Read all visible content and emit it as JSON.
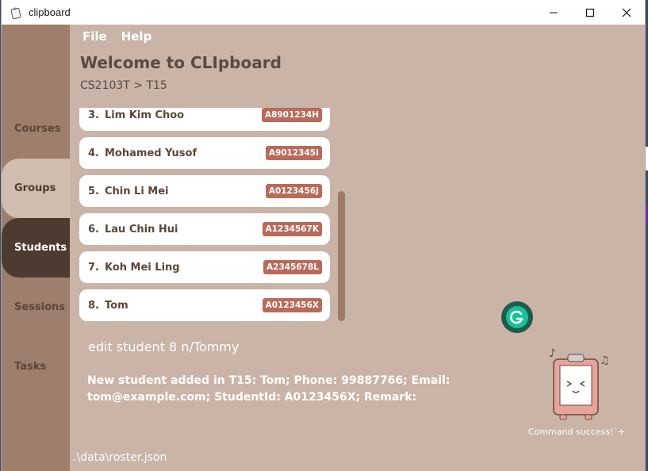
{
  "window": {
    "title": "clipboard",
    "icon": "clipboard-app-icon",
    "controls": [
      "minimize-icon",
      "maximize-icon",
      "close-icon"
    ]
  },
  "menu": {
    "file": "File",
    "help": "Help"
  },
  "sidebar": {
    "items": [
      {
        "label": "Courses",
        "state": "normal"
      },
      {
        "label": "Groups",
        "state": "hover"
      },
      {
        "label": "Students",
        "state": "active"
      },
      {
        "label": "Sessions",
        "state": "normal"
      },
      {
        "label": "Tasks",
        "state": "normal"
      }
    ]
  },
  "header": {
    "welcome": "Welcome to CLIpboard",
    "breadcrumb": "CS2103T > T15"
  },
  "students": [
    {
      "number": "3.",
      "name": "Lim Kim Choo",
      "id": "A8901234H"
    },
    {
      "number": "4.",
      "name": "Mohamed Yusof",
      "id": "A9012345I"
    },
    {
      "number": "5.",
      "name": "Chin Li Mei",
      "id": "A0123456J"
    },
    {
      "number": "6.",
      "name": "Lau Chin Hui",
      "id": "A1234567K"
    },
    {
      "number": "7.",
      "name": "Koh Mei Ling",
      "id": "A2345678L"
    },
    {
      "number": "8.",
      "name": "Tom",
      "id": "A0123456X"
    }
  ],
  "command": {
    "input": "edit student 8 n/Tommy"
  },
  "result": {
    "message": "New student added in T15: Tom; Phone: 99887766; Email: tom@example.com; StudentId: A0123456X; Remark:"
  },
  "status": {
    "mascot_caption": "Command success!`+"
  },
  "footer": {
    "path": ".\\data\\roster.json"
  },
  "colors": {
    "background": "#c9b4a7",
    "sidebar": "#9e7e6c",
    "active_tab": "#4d3b30",
    "id_badge": "#b96a5a"
  }
}
